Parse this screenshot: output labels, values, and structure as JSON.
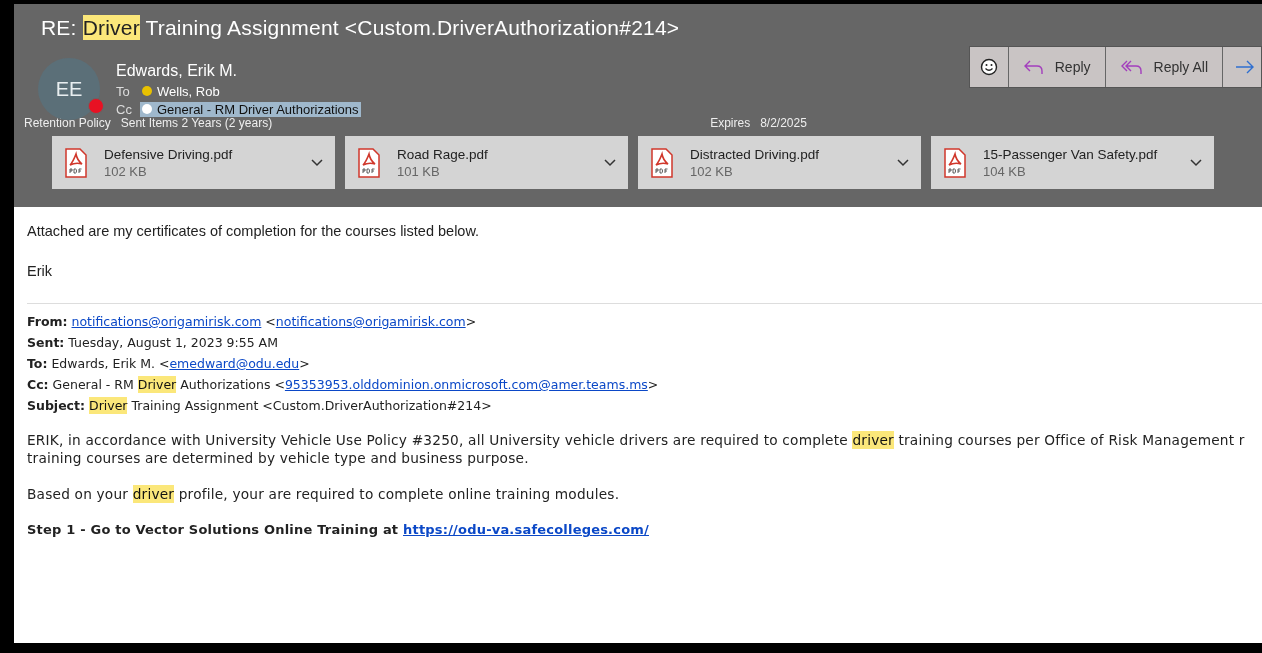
{
  "subject": [
    {
      "text": "RE: ",
      "highlighted": false
    },
    {
      "text": "Driver",
      "highlighted": true
    },
    {
      "text": " Training Assignment  <Custom.DriverAuthorization#214>",
      "highlighted": false
    }
  ],
  "sender": {
    "initials": "EE",
    "name": "Edwards, Erik M.",
    "busy": true
  },
  "recipients": [
    {
      "label": "To",
      "name": "Wells, Rob",
      "color": "#e8c100",
      "selected": false
    },
    {
      "label": "Cc",
      "name": "General - RM Driver Authorizations",
      "color": "#ffffff",
      "selected": true
    }
  ],
  "retention": {
    "label": "Retention Policy",
    "value": "Sent Items 2 Years (2 years)"
  },
  "expires": {
    "label": "Expires",
    "value": "8/2/2025"
  },
  "actions": [
    {
      "kind": "emoji"
    },
    {
      "kind": "reply",
      "label": "Reply"
    },
    {
      "kind": "reply_all",
      "label": "Reply All"
    },
    {
      "kind": "forward"
    }
  ],
  "attachments": [
    {
      "name": "Defensive Driving.pdf",
      "size": "102 KB"
    },
    {
      "name": "Road Rage.pdf",
      "size": "101 KB"
    },
    {
      "name": "Distracted Driving.pdf",
      "size": "102 KB"
    },
    {
      "name": "15-Passenger Van Safety.pdf",
      "size": "104 KB"
    }
  ],
  "body": [
    "Attached are my certificates of completion for the courses listed below.",
    "Erik"
  ],
  "forwarded": [
    {
      "label": "From:",
      "segments": [
        {
          "kind": "link",
          "text": "notifications@origamirisk.com"
        },
        {
          "kind": "text",
          "text": " <"
        },
        {
          "kind": "link",
          "text": "notifications@origamirisk.com"
        },
        {
          "kind": "text",
          "text": ">"
        }
      ]
    },
    {
      "label": "Sent:",
      "segments": [
        {
          "kind": "text",
          "text": "Tuesday, August 1, 2023 9:55 AM"
        }
      ]
    },
    {
      "label": "To:",
      "segments": [
        {
          "kind": "text",
          "text": "Edwards, Erik M. <"
        },
        {
          "kind": "link",
          "text": "emedward@odu.edu"
        },
        {
          "kind": "text",
          "text": ">"
        }
      ]
    },
    {
      "label": "Cc:",
      "segments": [
        {
          "kind": "text",
          "text": "General - RM "
        },
        {
          "kind": "mark",
          "text": "Driver"
        },
        {
          "kind": "text",
          "text": " Authorizations <"
        },
        {
          "kind": "link",
          "text": "95353953.olddominion.onmicrosoft.com@amer.teams.ms"
        },
        {
          "kind": "text",
          "text": ">"
        }
      ]
    },
    {
      "label": "Subject:",
      "segments": [
        {
          "kind": "mark",
          "text": "Driver"
        },
        {
          "kind": "text",
          "text": " Training Assignment <Custom.DriverAuthorization#214>"
        }
      ]
    }
  ],
  "message": [
    {
      "kind": "paragraph",
      "lines": [
        [
          {
            "kind": "text",
            "text": "ERIK, in accordance with University Vehicle Use Policy #3250, all University vehicle drivers are required to complete "
          },
          {
            "kind": "mark",
            "text": "driver"
          },
          {
            "kind": "text",
            "text": " training courses per Office of Risk Management r"
          }
        ],
        [
          {
            "kind": "text",
            "text": "training courses are determined by vehicle type and business purpose."
          }
        ]
      ]
    },
    {
      "kind": "paragraph",
      "lines": [
        [
          {
            "kind": "text",
            "text": "Based on your "
          },
          {
            "kind": "mark",
            "text": "driver"
          },
          {
            "kind": "text",
            "text": " profile, your are required to complete online training modules."
          }
        ]
      ]
    },
    {
      "kind": "step",
      "lines": [
        [
          {
            "kind": "text",
            "text": "Step 1 - Go to Vector Solutions Online Training at "
          },
          {
            "kind": "link",
            "text": "https://odu-va.safecolleges.com/"
          }
        ]
      ]
    }
  ]
}
